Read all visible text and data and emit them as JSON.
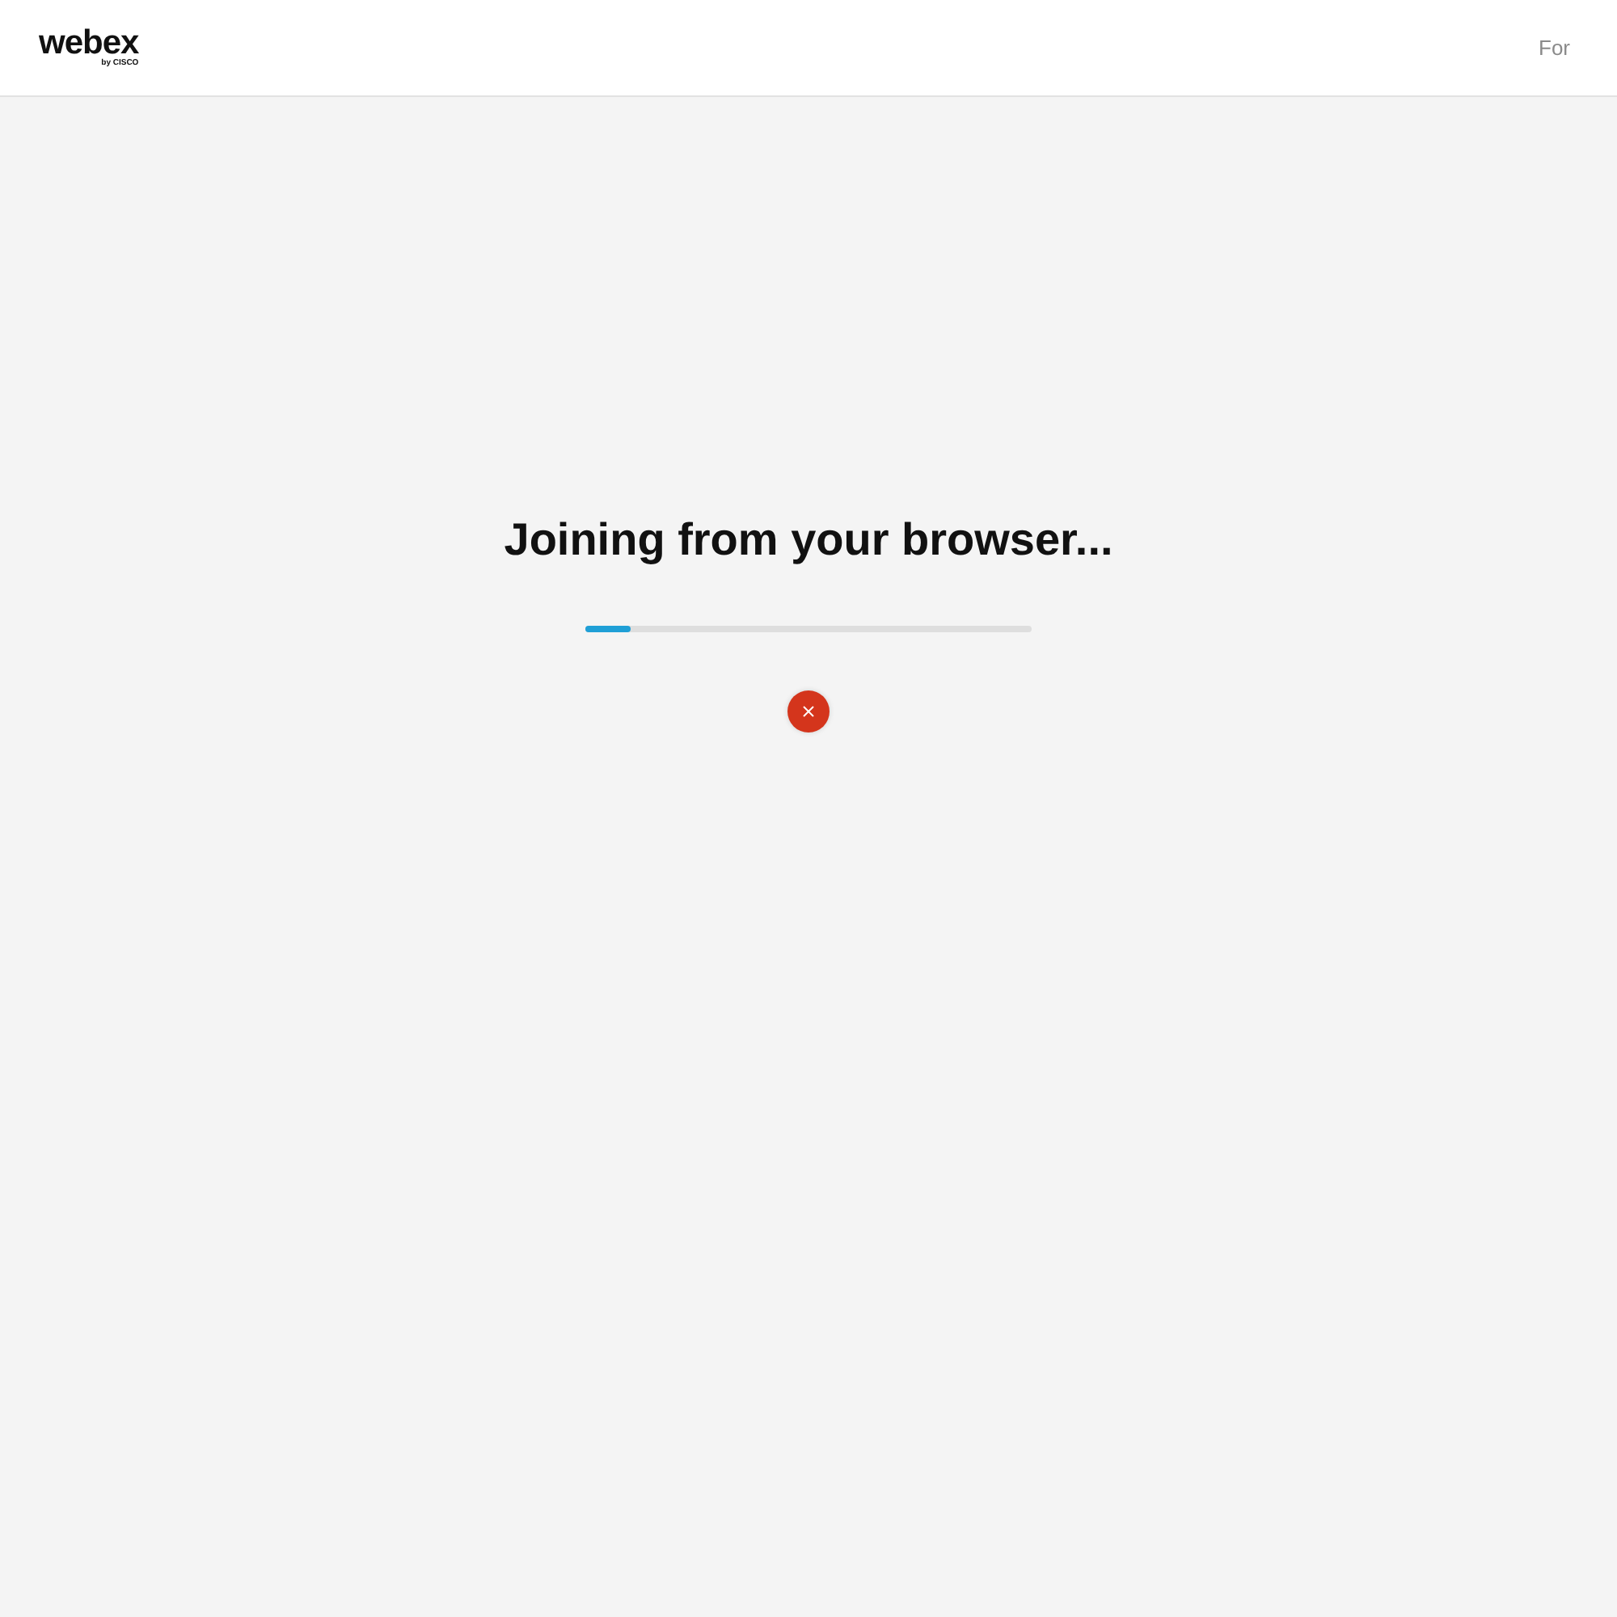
{
  "header": {
    "logo": {
      "name": "webex",
      "byline": "by CISCO"
    },
    "link": "For"
  },
  "main": {
    "title": "Joining from your browser...",
    "progress": {
      "level": 0.1
    },
    "cancel_button": {
      "kind": "close"
    }
  }
}
